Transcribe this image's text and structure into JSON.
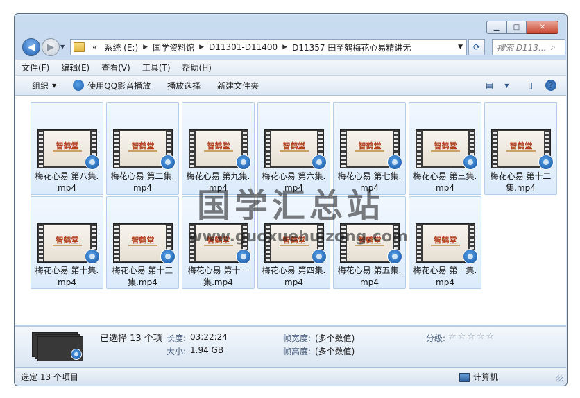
{
  "window": {
    "buttons": {
      "minimize": "▁",
      "maximize": "□",
      "close": "✕"
    }
  },
  "nav": {
    "back_glyph": "◀",
    "forward_glyph": "▶",
    "dropdown_glyph": "▼"
  },
  "address": {
    "chevron": "«",
    "crumbs": [
      "系统 (E:)",
      "国学资料馆",
      "D11301-D11400",
      "D11357 田至鹤梅花心易精讲无"
    ],
    "separator": "▶",
    "dropdown_glyph": "▼",
    "refresh_glyph": "⟳"
  },
  "search": {
    "placeholder": "搜索 D113...",
    "icon": "search-icon",
    "glyph": "⌕"
  },
  "menu": [
    "文件(F)",
    "编辑(E)",
    "查看(V)",
    "工具(T)",
    "帮助(H)"
  ],
  "toolbar": {
    "organize": "组织",
    "arrow": "▼",
    "play_qq": "使用QQ影音播放",
    "play_selected": "播放选择",
    "new_folder": "新建文件夹",
    "view_glyph": "▤",
    "view_arrow": "▼",
    "pane_glyph": "▯",
    "help_glyph": "?"
  },
  "files": [
    {
      "name": "梅花心易 第八集.mp4"
    },
    {
      "name": "梅花心易 第二集.mp4"
    },
    {
      "name": "梅花心易 第九集.mp4"
    },
    {
      "name": "梅花心易 第六集.mp4"
    },
    {
      "name": "梅花心易 第七集.mp4"
    },
    {
      "name": "梅花心易 第三集.mp4"
    },
    {
      "name": "梅花心易 第十二集.mp4"
    },
    {
      "name": "梅花心易 第十集.mp4"
    },
    {
      "name": "梅花心易 第十三集.mp4"
    },
    {
      "name": "梅花心易 第十一集.mp4"
    },
    {
      "name": "梅花心易 第四集.mp4"
    },
    {
      "name": "梅花心易 第五集.mp4"
    },
    {
      "name": "梅花心易 第一集.mp4"
    }
  ],
  "thumb_brand": "智鹤堂",
  "watermark": {
    "title": "国学汇总站",
    "url": "www.guoxuehuizong.com"
  },
  "details": {
    "selected": "已选择 13 个项",
    "length_label": "长度:",
    "length_value": "03:22:24",
    "size_label": "大小:",
    "size_value": "1.94 GB",
    "width_label": "帧宽度:",
    "width_value": "(多个数值)",
    "height_label": "帧高度:",
    "height_value": "(多个数值)",
    "rating_label": "分级:",
    "rating_stars": "☆☆☆☆☆"
  },
  "status": {
    "text": "选定 13 个项目",
    "location": "计算机"
  }
}
